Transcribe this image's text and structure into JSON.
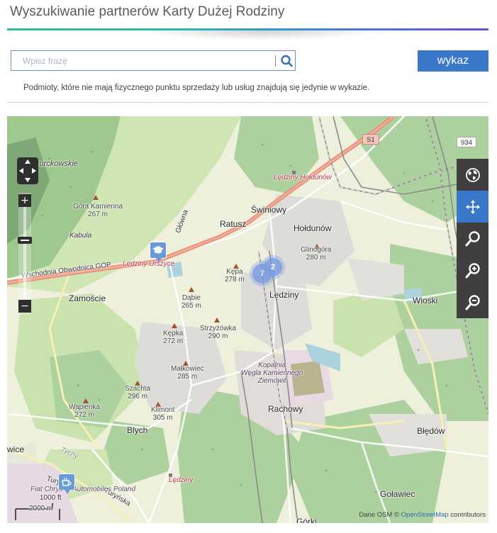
{
  "header": {
    "title": "Wyszukiwanie partnerów Karty Dużej Rodziny"
  },
  "search": {
    "placeholder": "Wpisz frazę",
    "value": ""
  },
  "list_button": {
    "label": "wykaz"
  },
  "note": "Podmioty, które nie mają fizycznego punktu sprzedaży lub usług znajdują się jedynie w wykazie.",
  "map": {
    "towns": [
      {
        "name": "Świniowy"
      },
      {
        "name": "Hołdunów"
      },
      {
        "name": "Ratusz"
      },
      {
        "name": "Lędziny"
      },
      {
        "name": "Zamoście"
      },
      {
        "name": "Wioski"
      },
      {
        "name": "Rachowy"
      },
      {
        "name": "Blych"
      },
      {
        "name": "Błędów"
      },
      {
        "name": "Goławiec"
      },
      {
        "name": "Górki"
      },
      {
        "name": "wice"
      },
      {
        "name": "Kabula"
      },
      {
        "name": "zurckowskie"
      }
    ],
    "peaks": [
      {
        "name": "Góra Kamienna",
        "elevation": "267 m"
      },
      {
        "name": "Glinogóra",
        "elevation": "280 m"
      },
      {
        "name": "Kępa",
        "elevation": "278 m"
      },
      {
        "name": "Dąbie",
        "elevation": "265 m"
      },
      {
        "name": "Kępka",
        "elevation": "272 m"
      },
      {
        "name": "Strzyżówka",
        "elevation": "290 m"
      },
      {
        "name": "Małkowiec",
        "elevation": "285 m"
      },
      {
        "name": "Szachta",
        "elevation": "296 m"
      },
      {
        "name": "Wapienka",
        "elevation": "272 m"
      },
      {
        "name": "Klimont",
        "elevation": "305 m"
      }
    ],
    "stations": [
      "Lędziny Hołdunów",
      "Lędziny Urszyce",
      "Lędziny"
    ],
    "road_labels": [
      "Wschodnia Obwodnica GOP",
      "Tychy",
      "Turyńska",
      "Turyńska",
      "Główna",
      "Fiat Chrysler Automobiles Poland"
    ],
    "mine_label": [
      "Kopalnia",
      "Węgla Kamiennego",
      "Ziemowit"
    ],
    "shields": [
      "S1",
      "934"
    ],
    "clusters": [
      {
        "count": "7"
      },
      {
        "count": "2"
      }
    ],
    "scale": {
      "top": "1000 ft",
      "bottom": "2000 m"
    },
    "attribution": {
      "prefix": "Dane OSM ©",
      "link": "OpenStreetMap",
      "suffix": "contributors"
    },
    "colors": {
      "accent": "#3a78c9",
      "forest": "#add19e",
      "residential": "#dcdcdc",
      "motorway": "#e8927c",
      "railway": "#8a8a8a",
      "tool_panel": "#3f3f3f",
      "cluster": "#7a9be0"
    },
    "tool_icons": [
      "globe-icon",
      "move-icon",
      "search-icon",
      "zoom-in-icon",
      "zoom-out-icon"
    ],
    "active_tool": "move-icon"
  }
}
